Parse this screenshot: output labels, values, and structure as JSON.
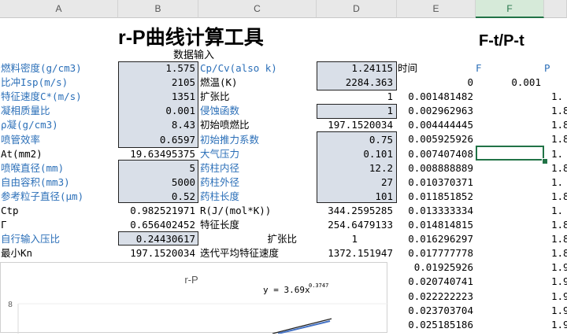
{
  "columns": [
    "A",
    "B",
    "C",
    "D",
    "E",
    "F"
  ],
  "titles": {
    "main": "r-P曲线计算工具",
    "sub": "数据输入",
    "side": "F-t/P-t"
  },
  "rows_left": [
    {
      "label": "燃料密度(g/cm3)",
      "value": "1.575",
      "label2": "Cp/Cv(also k)",
      "value2": "1.24115"
    },
    {
      "label": "比冲Isp(m/s)",
      "value": "2105",
      "label2": "燃温(K)",
      "value2": "2284.363"
    },
    {
      "label": "特征速度C*(m/s)",
      "value": "1351",
      "label2": "扩张比",
      "value2": "1"
    },
    {
      "label": "凝相质量比",
      "value": "0.001",
      "label2": "侵蚀函数",
      "value2": "1"
    },
    {
      "label": "ρ凝(g/cm3)",
      "value": "8.43",
      "label2": "初始喷燃比",
      "value2": "197.1520034"
    },
    {
      "label": "喷管效率",
      "value": "0.6597",
      "label2": "初始推力系数",
      "value2": "0.75"
    },
    {
      "label": "At(mm2)",
      "value": "19.63495375",
      "label2": "大气压力",
      "value2": "0.101"
    },
    {
      "label": "喷喉直径(mm)",
      "value": "5",
      "label2": "药柱内径",
      "value2": "12.2"
    },
    {
      "label": "自由容积(mm3)",
      "value": "5000",
      "label2": "药柱外径",
      "value2": "27"
    },
    {
      "label": "参考粒子直径(μm)",
      "value": "0.52",
      "label2": "药柱长度",
      "value2": "101"
    },
    {
      "label": "Ctp",
      "value": "0.982521971",
      "label2": "R(J/(mol*K))",
      "value2": "344.2595285"
    },
    {
      "label": "Γ",
      "value": "0.656402452",
      "label2": "特征长度",
      "value2": "254.6479133"
    },
    {
      "label": "自行输入压比",
      "value": "0.24430617",
      "label2": "扩张比",
      "value2": "1"
    },
    {
      "label": "最小Kn",
      "value": "197.1520034",
      "label2": "迭代平均特征速度",
      "value2": "1372.151947"
    }
  ],
  "time_header": {
    "t": "时间",
    "f": "F",
    "p": "P"
  },
  "time_rows": [
    {
      "t": "0",
      "f": "0.001",
      "p": ""
    },
    {
      "t": "0.001481482",
      "f": "",
      "p": "1."
    },
    {
      "t": "0.002962963",
      "f": "",
      "p": "1.8"
    },
    {
      "t": "0.004444445",
      "f": "",
      "p": "1.8"
    },
    {
      "t": "0.005925926",
      "f": "",
      "p": "1.8"
    },
    {
      "t": "0.007407408",
      "f": "",
      "p": "1."
    },
    {
      "t": "0.008888889",
      "f": "",
      "p": "1.8"
    },
    {
      "t": "0.010370371",
      "f": "",
      "p": "1."
    },
    {
      "t": "0.011851852",
      "f": "",
      "p": "1.8"
    },
    {
      "t": "0.013333334",
      "f": "",
      "p": "1."
    },
    {
      "t": "0.014814815",
      "f": "",
      "p": "1.8"
    },
    {
      "t": "0.016296297",
      "f": "",
      "p": "1.8"
    },
    {
      "t": "0.017777778",
      "f": "",
      "p": "1.8"
    },
    {
      "t": "0.01925926",
      "f": "",
      "p": "1.9"
    },
    {
      "t": "0.020740741",
      "f": "",
      "p": "1.9"
    },
    {
      "t": "0.022222223",
      "f": "",
      "p": "1.9"
    },
    {
      "t": "0.023703704",
      "f": "",
      "p": "1.9"
    },
    {
      "t": "0.025185186",
      "f": "",
      "p": "1.9"
    }
  ],
  "chart_data": {
    "type": "scatter",
    "title": "r-P",
    "trendline": {
      "label": "y = 3.69x",
      "exponent": "0.3747",
      "coef": 3.69,
      "exp": 0.3747
    },
    "ylim": [
      0,
      8
    ],
    "y_ticks": [
      "8"
    ],
    "colors": {
      "series": "#4472c4",
      "trend": "#1f1f1f"
    }
  }
}
